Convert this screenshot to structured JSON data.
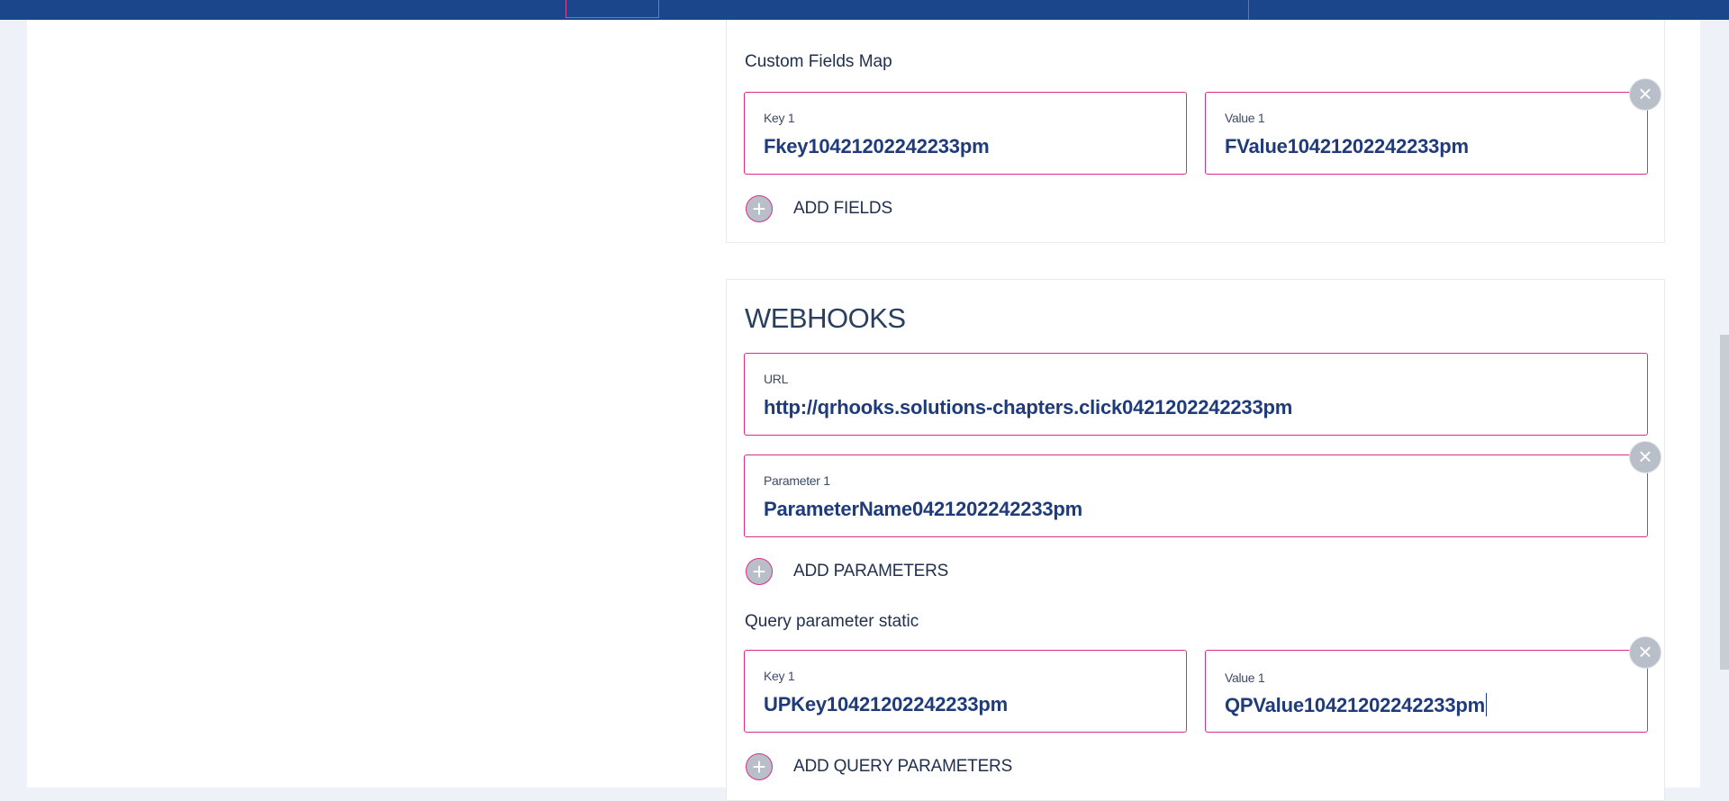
{
  "custom_fields": {
    "title": "Custom Fields Map",
    "key_label": "Key 1",
    "key_value": "Fkey10421202242233pm",
    "value_label": "Value 1",
    "value_value": "FValue10421202242233pm",
    "add_label": "ADD FIELDS"
  },
  "webhooks": {
    "heading": "WEBHOOKS",
    "url_label": "URL",
    "url_value": "http://qrhooks.solutions-chapters.click0421202242233pm",
    "param_label": "Parameter 1",
    "param_value": "ParameterName0421202242233pm",
    "add_params_label": "ADD PARAMETERS",
    "query_title": "Query parameter static",
    "query_key_label": "Key 1",
    "query_key_value": "UPKey10421202242233pm",
    "query_value_label": "Value 1",
    "query_value_value": "QPValue10421202242233pm",
    "add_query_label": "ADD QUERY PARAMETERS"
  },
  "icons": {
    "remove": "close-icon",
    "add": "plus-icon"
  },
  "colors": {
    "topbar": "#1b468b",
    "field_border": "#d72f8a",
    "value_text": "#1f3b7a"
  }
}
